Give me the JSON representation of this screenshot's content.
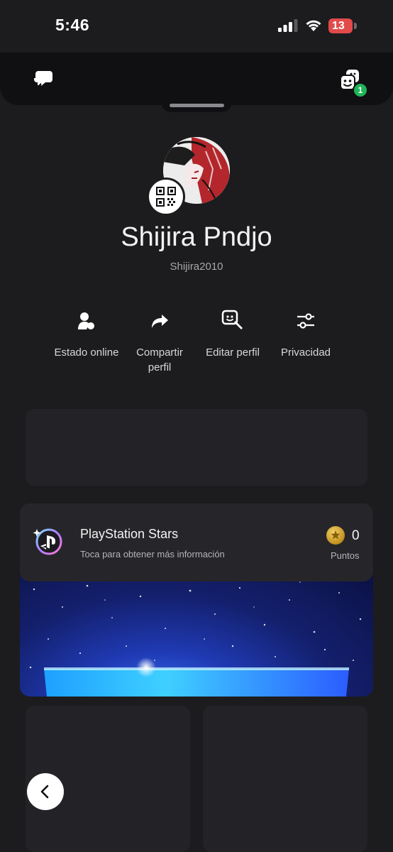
{
  "status_bar": {
    "time": "5:46",
    "battery": "13",
    "icons": [
      "cellular-signal-icon",
      "wifi-icon",
      "battery-charging-icon"
    ]
  },
  "header": {
    "left_icon": "chat-bubbles-icon",
    "right_icon": "party-icon",
    "party_badge": "1"
  },
  "profile": {
    "display_name": "Shijira Pndjo",
    "username": "Shijira2010",
    "qr_icon": "qr-code-icon"
  },
  "actions": [
    {
      "label": "Estado online",
      "icon": "online-status-icon"
    },
    {
      "label": "Compartir perfil",
      "icon": "share-arrow-icon"
    },
    {
      "label": "Editar perfil",
      "icon": "edit-profile-icon"
    },
    {
      "label": "Privacidad",
      "icon": "sliders-icon"
    }
  ],
  "stars": {
    "title": "PlayStation Stars",
    "subtitle": "Toca para obtener más información",
    "points_value": "0",
    "points_label": "Puntos"
  },
  "colors": {
    "background": "#1c1c1f",
    "top_sheet": "#101012",
    "card": "#26262a",
    "badge_green": "#1fb557",
    "battery_red": "#e24a4a"
  }
}
